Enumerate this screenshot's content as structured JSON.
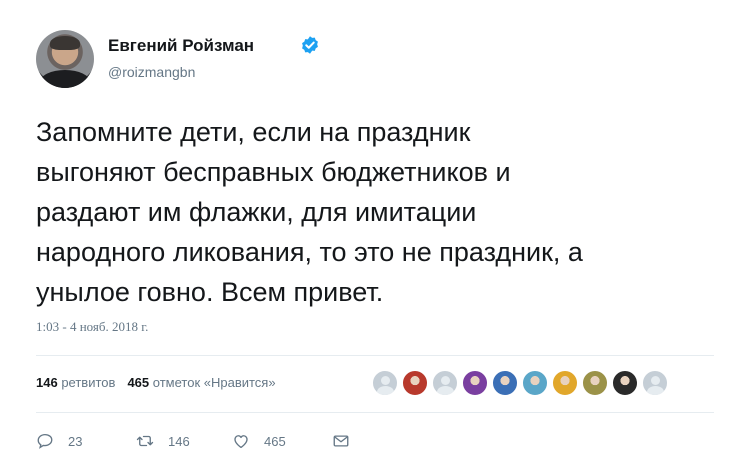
{
  "author": {
    "name": "Евгений Ройзман",
    "handle": "@roizmangbn",
    "verified": true
  },
  "tweet": {
    "text": "Запомните дети, если на праздник\nвыгоняют бесправных бюджетников и\nраздают им флажки, для имитации\nнародного ликования, то это не праздник, а\nунылое говно. Всем привет.",
    "timestamp": "1:03 - 4 нояб. 2018 г."
  },
  "stats": {
    "retweets_count": "146",
    "retweets_label": "ретвитов",
    "likes_count": "465",
    "likes_label": "отметок «Нравится»"
  },
  "likers": [
    {
      "kind": "default",
      "color": "#c5ced6"
    },
    {
      "kind": "photo",
      "color": "#b8392c"
    },
    {
      "kind": "default",
      "color": "#c5ced6"
    },
    {
      "kind": "photo",
      "color": "#7a3fa0"
    },
    {
      "kind": "photo",
      "color": "#3b6fb6"
    },
    {
      "kind": "photo",
      "color": "#5aa6c8"
    },
    {
      "kind": "photo",
      "color": "#e1a72b"
    },
    {
      "kind": "photo",
      "color": "#9b9248"
    },
    {
      "kind": "photo",
      "color": "#2a2a2a"
    },
    {
      "kind": "default",
      "color": "#c5ced6"
    }
  ],
  "actions": {
    "reply_count": "23",
    "retweet_count": "146",
    "like_count": "465"
  },
  "colors": {
    "text": "#14171a",
    "secondary": "#657786",
    "verified": "#1da1f2",
    "divider": "#e6ecf0"
  },
  "icons": [
    "verified-badge-icon",
    "reply-icon",
    "retweet-icon",
    "like-icon",
    "message-icon"
  ]
}
